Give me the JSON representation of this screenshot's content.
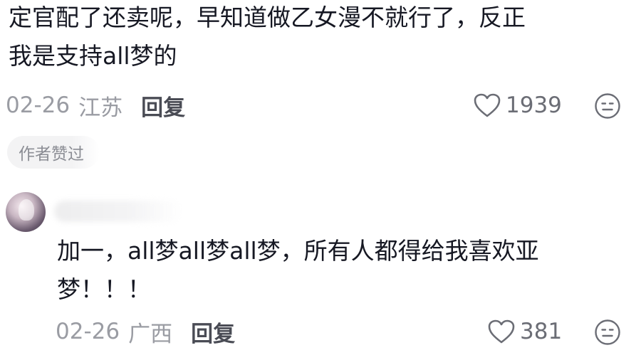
{
  "comments": [
    {
      "text": "定官配了还卖呢，早知道做乙女漫不就行了，反正\n我是支持all梦的",
      "date": "02-26",
      "location": "江苏",
      "reply_label": "回复",
      "likes": "1939",
      "badge": "作者赞过"
    },
    {
      "text": "加一，all梦all梦all梦，所有人都得给我喜欢亚\n梦！！！",
      "date": "02-26",
      "location": "广西",
      "reply_label": "回复",
      "likes": "381"
    }
  ],
  "icons": {
    "like": "heart-outline-icon",
    "reaction": "emoji-face-icon"
  },
  "colors": {
    "text": "#161823",
    "meta": "#9a9ca3",
    "reply": "#4a4c55",
    "badge_bg": "#f3f3f4"
  }
}
